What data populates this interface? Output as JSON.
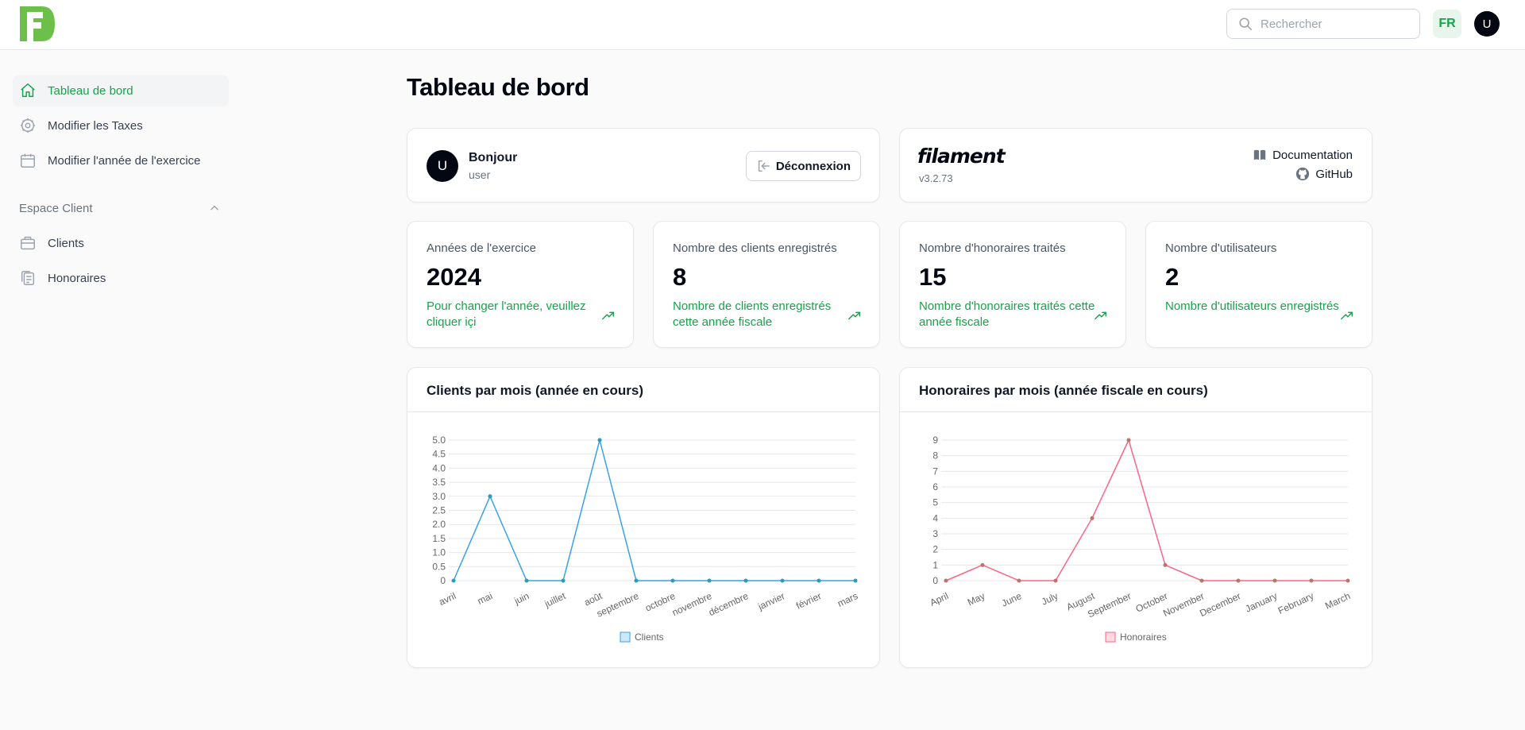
{
  "header": {
    "logo": "filament-logo",
    "search_placeholder": "Rechercher",
    "language": "FR",
    "user_initial": "U"
  },
  "sidebar": {
    "items": [
      {
        "label": "Tableau de bord",
        "icon": "home-icon",
        "active": true
      },
      {
        "label": "Modifier les Taxes",
        "icon": "cog-icon",
        "active": false
      },
      {
        "label": "Modifier l'année de l'exercice",
        "icon": "calendar-icon",
        "active": false
      }
    ],
    "group": {
      "label": "Espace Client",
      "items": [
        {
          "label": "Clients",
          "icon": "briefcase-icon"
        },
        {
          "label": "Honoraires",
          "icon": "clipboard-copy-icon"
        }
      ]
    }
  },
  "page": {
    "title": "Tableau de bord"
  },
  "welcome": {
    "greeting": "Bonjour",
    "username": "user",
    "initial": "U",
    "logout_label": "Déconnexion"
  },
  "filament_info": {
    "brand": "filament",
    "version": "v3.2.73",
    "docs_label": "Documentation",
    "github_label": "GitHub"
  },
  "stats": [
    {
      "label": "Années de l'exercice",
      "value": "2024",
      "description": "Pour changer l'année, veuillez cliquer içi"
    },
    {
      "label": "Nombre des clients enregistrés",
      "value": "8",
      "description": "Nombre de clients enregistrés cette année fiscale"
    },
    {
      "label": "Nombre d'honoraires traités",
      "value": "15",
      "description": "Nombre d'honoraires traités cette année fiscale"
    },
    {
      "label": "Nombre d'utilisateurs",
      "value": "2",
      "description": "Nombre d'utilisateurs enregistrés"
    }
  ],
  "colors": {
    "accent": "#16a34a",
    "clients_line": "#36a2eb",
    "honoraires_line": "#ff6384"
  },
  "chart_titles": {
    "clients": "Clients par mois (année en cours)",
    "honoraires": "Honoraires par mois (année fiscale en cours)"
  },
  "chart_data": [
    {
      "type": "line",
      "title": "Clients par mois (année en cours)",
      "categories": [
        "avril",
        "mai",
        "juin",
        "juillet",
        "août",
        "septembre",
        "octobre",
        "novembre",
        "décembre",
        "janvier",
        "février",
        "mars"
      ],
      "series": [
        {
          "name": "Clients",
          "values": [
            0,
            3,
            0,
            0,
            5,
            0,
            0,
            0,
            0,
            0,
            0,
            0
          ]
        }
      ],
      "ylim": [
        0,
        5
      ],
      "yticks": [
        "0",
        "0.5",
        "1.0",
        "1.5",
        "2.0",
        "2.5",
        "3.0",
        "3.5",
        "4.0",
        "4.5",
        "5.0"
      ],
      "legend": "bottom",
      "grid": true
    },
    {
      "type": "line",
      "title": "Honoraires par mois (année fiscale en cours)",
      "categories": [
        "April",
        "May",
        "June",
        "July",
        "August",
        "September",
        "October",
        "November",
        "December",
        "January",
        "February",
        "March"
      ],
      "series": [
        {
          "name": "Honoraires",
          "values": [
            0,
            1,
            0,
            0,
            4,
            9,
            1,
            0,
            0,
            0,
            0,
            0
          ]
        }
      ],
      "ylim": [
        0,
        9
      ],
      "yticks": [
        "0",
        "1",
        "2",
        "3",
        "4",
        "5",
        "6",
        "7",
        "8",
        "9"
      ],
      "legend": "bottom",
      "grid": true
    }
  ]
}
